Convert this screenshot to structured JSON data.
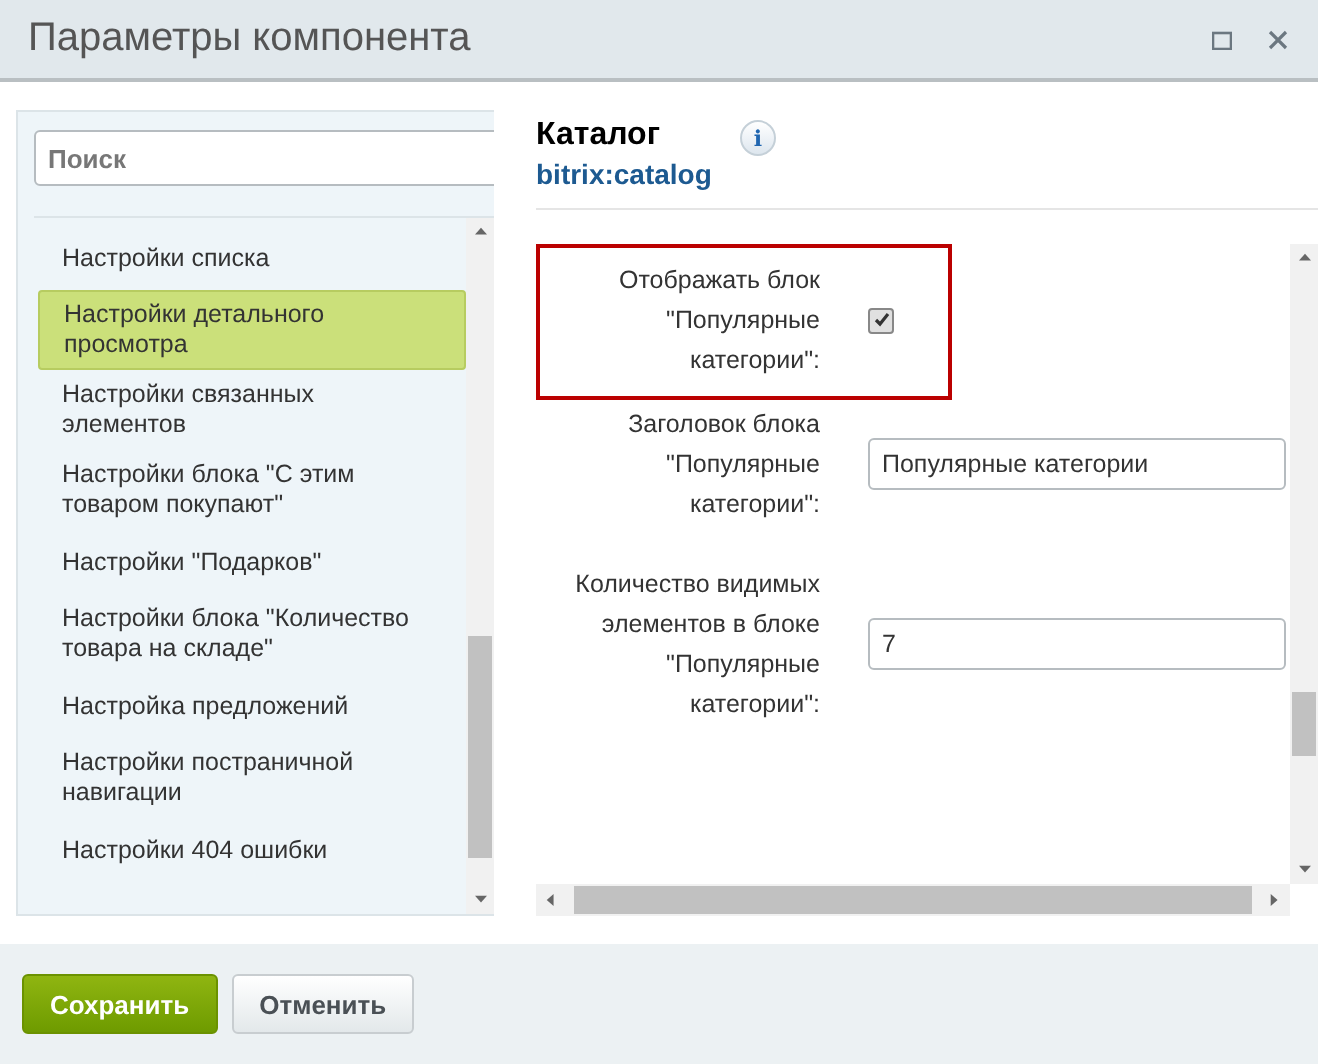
{
  "window": {
    "title": "Параметры компонента"
  },
  "sidebar": {
    "search": {
      "placeholder": "Поиск"
    },
    "items": [
      {
        "label": "Настройки списка",
        "selected": false
      },
      {
        "label": "Настройки детального просмотра",
        "selected": true
      },
      {
        "label": "Настройки связанных элементов",
        "selected": false
      },
      {
        "label": "Настройки блока \"С этим товаром покупают\"",
        "selected": false
      },
      {
        "label": "Настройки \"Подарков\"",
        "selected": false
      },
      {
        "label": "Настройки блока \"Количество товара на складе\"",
        "selected": false
      },
      {
        "label": "Настройка предложений",
        "selected": false
      },
      {
        "label": "Настройки постраничной навигации",
        "selected": false
      },
      {
        "label": "Настройки 404 ошибки",
        "selected": false
      }
    ]
  },
  "component": {
    "title": "Каталог",
    "code": "bitrix:catalog",
    "info_button": "i"
  },
  "fields": [
    {
      "kind": "checkbox",
      "label": "Отображать блок \"Популярные категории\":",
      "checked": true,
      "highlighted": true
    },
    {
      "kind": "text",
      "label": "Заголовок блока \"Популярные категории\":",
      "value": "Популярные категории",
      "highlighted": false
    },
    {
      "kind": "text",
      "label": "Количество видимых элементов в блоке \"Популярные категории\":",
      "value": "7",
      "highlighted": false
    }
  ],
  "buttons": [
    {
      "label": "Сохранить",
      "kind": "primary"
    },
    {
      "label": "Отменить",
      "kind": "secondary"
    }
  ]
}
